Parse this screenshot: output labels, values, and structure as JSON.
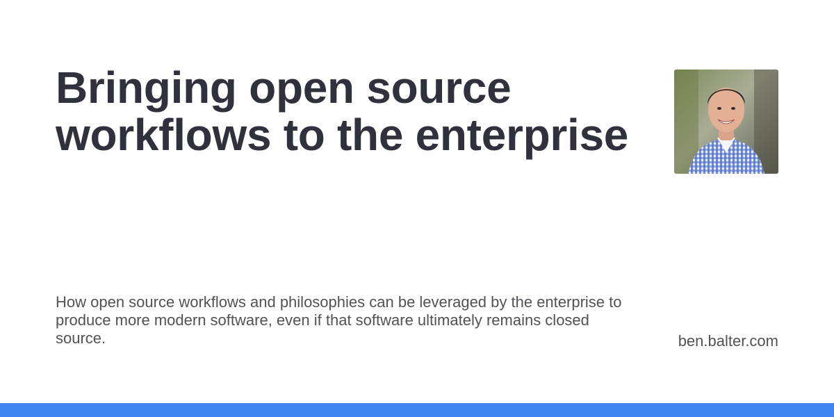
{
  "card": {
    "title_line_1": "Bringing open source",
    "title_line_2": "workflows to the enterprise",
    "description": "How open source workflows and philosophies can be leveraged by the enterprise to produce more modern software, even if that software ultimately remains closed source.",
    "site": "ben.balter.com",
    "avatar": "author-photo",
    "accent_color": "#4183f0"
  }
}
